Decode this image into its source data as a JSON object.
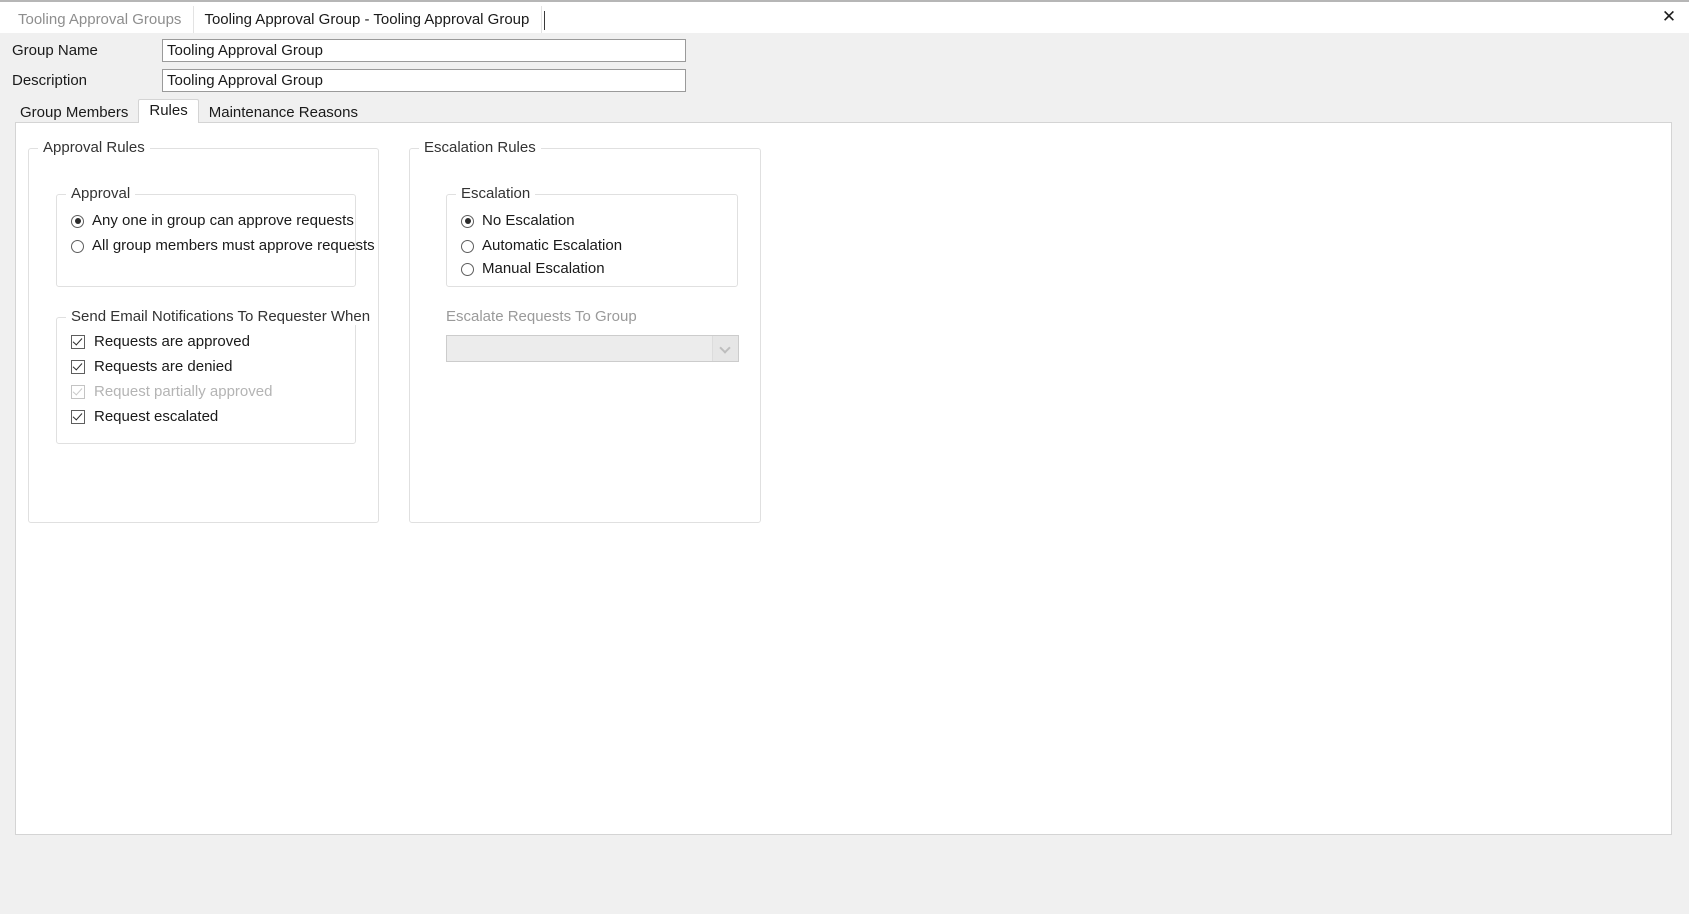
{
  "window": {
    "close_icon": "close-icon",
    "close_glyph": "✕"
  },
  "document_tabs": [
    {
      "label": "Tooling Approval Groups",
      "active": false
    },
    {
      "label": "Tooling Approval Group - Tooling Approval Group",
      "active": true
    }
  ],
  "fields": [
    {
      "label": "Group Name",
      "value": "Tooling Approval Group",
      "placeholder": ""
    },
    {
      "label": "Description",
      "value": "Tooling Approval Group",
      "placeholder": ""
    }
  ],
  "inner_tabs": [
    {
      "label": "Group Members",
      "active": false
    },
    {
      "label": "Rules",
      "active": true
    },
    {
      "label": "Maintenance Reasons",
      "active": false
    }
  ],
  "approval_rules": {
    "title": "Approval Rules",
    "approval": {
      "title": "Approval",
      "options": [
        {
          "label": "Any one in group can approve requests",
          "selected": true
        },
        {
          "label": "All group members must approve requests",
          "selected": false
        }
      ]
    },
    "email_notifications": {
      "title": "Send Email Notifications To Requester When",
      "options": [
        {
          "label": "Requests are approved",
          "checked": true,
          "disabled": false
        },
        {
          "label": "Requests are denied",
          "checked": true,
          "disabled": false
        },
        {
          "label": "Request partially approved",
          "checked": true,
          "disabled": true
        },
        {
          "label": "Request escalated",
          "checked": true,
          "disabled": false
        }
      ]
    }
  },
  "escalation_rules": {
    "title": "Escalation Rules",
    "escalation": {
      "title": "Escalation",
      "options": [
        {
          "label": "No Escalation",
          "selected": true
        },
        {
          "label": "Automatic Escalation",
          "selected": false
        },
        {
          "label": "Manual Escalation",
          "selected": false
        }
      ]
    },
    "escalate_to_group": {
      "label": "Escalate Requests To Group",
      "value": "",
      "disabled": true,
      "chevron_icon": "chevron-down-icon"
    }
  },
  "colors": {
    "window_bg": "#f0f0f0",
    "panel_bg": "#ffffff",
    "border": "#d4d4d4",
    "group_border": "#e0e0e0",
    "text": "#1a1a1a",
    "disabled_text": "#b4b4b4",
    "inactive_tab_text": "#8e8e8e"
  }
}
